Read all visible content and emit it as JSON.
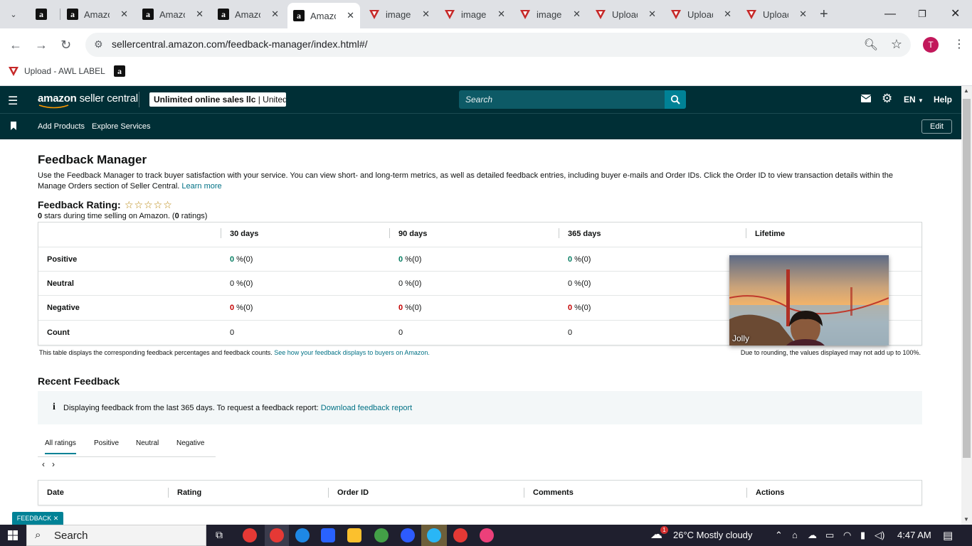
{
  "browser": {
    "tabs": [
      {
        "title": "",
        "favicon": "amazon-a-icon",
        "active": false
      },
      {
        "title": "Amazon",
        "favicon": "amazon-a-icon",
        "active": false
      },
      {
        "title": "Amazon",
        "favicon": "amazon-a-icon",
        "active": false
      },
      {
        "title": "Amazon",
        "favicon": "amazon-a-icon",
        "active": false
      },
      {
        "title": "Amazon",
        "favicon": "amazon-a-icon",
        "active": true
      },
      {
        "title": "image",
        "favicon": "v-brand-icon",
        "active": false
      },
      {
        "title": "image",
        "favicon": "v-brand-icon",
        "active": false
      },
      {
        "title": "image",
        "favicon": "v-brand-icon",
        "active": false
      },
      {
        "title": "Upload",
        "favicon": "v-brand-icon",
        "active": false
      },
      {
        "title": "Upload",
        "favicon": "v-brand-icon",
        "active": false
      },
      {
        "title": "Upload",
        "favicon": "v-brand-icon",
        "active": false
      }
    ],
    "url": "sellercentral.amazon.com/feedback-manager/index.html#/",
    "profile_initial": "T",
    "bookmarks": [
      {
        "label": "Upload - AWL LABEL",
        "icon": "v-brand-icon"
      },
      {
        "label": "",
        "icon": "amazon-a-icon"
      }
    ]
  },
  "seller_central": {
    "logo_prefix": "amazon",
    "logo_suffix": " seller central",
    "store_name": "Unlimited online sales llc",
    "store_region": " | United...",
    "search_placeholder": "Search",
    "language": "EN",
    "help": "Help",
    "nav": {
      "add_products": "Add Products",
      "explore_services": "Explore Services",
      "edit": "Edit"
    }
  },
  "page": {
    "title": "Feedback Manager",
    "intro": "Use the Feedback Manager to track buyer satisfaction with your service. You can view short- and long-term metrics, as well as detailed feedback entries, including buyer e-mails and Order IDs. Click the Order ID to view transaction details within the Manage Orders section of Seller Central.",
    "learn_more": "Learn more",
    "rating_heading": "Feedback Rating:",
    "stars_display": "☆☆☆☆☆",
    "stars_count": "0",
    "stars_text": " stars during time selling on Amazon. (",
    "ratings_count": "0",
    "ratings_text": " ratings)"
  },
  "feedback_table": {
    "columns": [
      "30 days",
      "90 days",
      "365 days",
      "Lifetime"
    ],
    "rows": [
      {
        "label": "Positive",
        "values": [
          "0",
          "0",
          "0"
        ],
        "suffix": " %(0)"
      },
      {
        "label": "Neutral",
        "values": [
          "0",
          "0",
          "0"
        ],
        "suffix": " %(0)"
      },
      {
        "label": "Negative",
        "values": [
          "0",
          "0",
          "0"
        ],
        "suffix": " %(0)"
      },
      {
        "label": "Count",
        "values": [
          "0",
          "0",
          "0"
        ],
        "suffix": ""
      }
    ],
    "note_left": "This table displays the corresponding feedback percentages and feedback counts.",
    "note_link": "See how your feedback displays to buyers on Amazon.",
    "note_right": "Due to rounding, the values displayed may not add up to 100%."
  },
  "recent": {
    "heading": "Recent Feedback",
    "info_text": "Displaying feedback from the last 365 days. To request a feedback report:",
    "info_link": "Download feedback report",
    "tabs": [
      "All ratings",
      "Positive",
      "Neutral",
      "Negative"
    ],
    "active_tab": "All ratings",
    "pager_prev": "‹",
    "pager_next": "›",
    "columns": [
      "Date",
      "Rating",
      "Order ID",
      "Comments",
      "Actions"
    ]
  },
  "video_overlay": {
    "participant": "Jolly"
  },
  "feedback_tag": "FEEDBACK ✕",
  "taskbar": {
    "search_label": "Search",
    "weather": "26°C  Mostly cloudy",
    "weather_badge": "1",
    "time": "4:47 AM"
  },
  "colors": {
    "sc_header": "#002f36",
    "accent_teal": "#008296",
    "link": "#007185",
    "positive": "#067d62",
    "negative": "#c40000"
  }
}
